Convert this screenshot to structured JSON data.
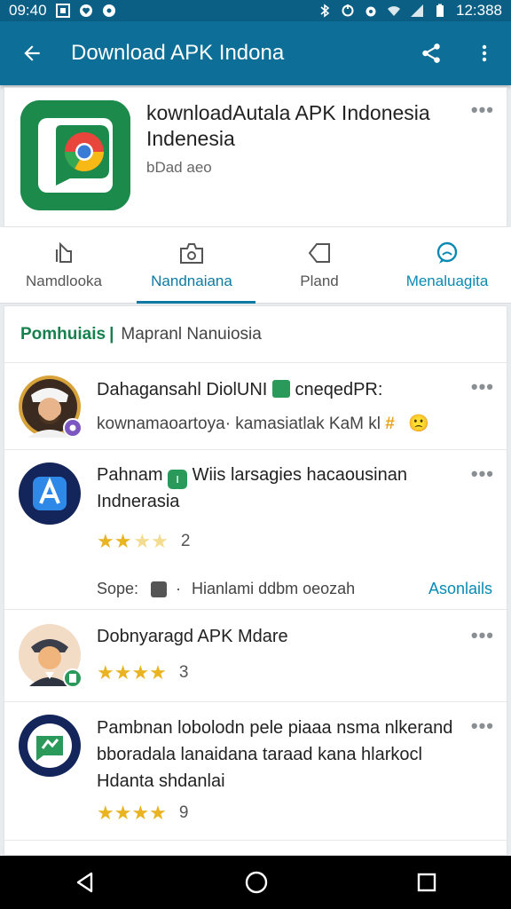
{
  "status_bar": {
    "time_left": "09:40",
    "time_right": "12:388",
    "icons": [
      "image-icon",
      "heart-icon",
      "chat-icon",
      "bluetooth-icon",
      "sync-icon",
      "alarm-icon",
      "wifi-icon",
      "signal-icon",
      "battery-icon"
    ]
  },
  "app_bar": {
    "title": "Download APK Indona",
    "back_icon": "arrow-back-icon",
    "share_icon": "share-icon",
    "menu_icon": "more-vert-icon"
  },
  "app_card": {
    "name": "kownloadAutala APK  Indonesia Indenesia",
    "subtitle": "bDad aeo",
    "more": "•••"
  },
  "tabs": [
    {
      "label": "Namdlooka",
      "icon": "download-icon",
      "active": false
    },
    {
      "label": "Nandnaiana",
      "icon": "camera-icon",
      "active": true
    },
    {
      "label": "Pland",
      "icon": "tag-icon",
      "active": false
    },
    {
      "label": "Menaluagita",
      "icon": "chat-bubble-icon",
      "active": false
    }
  ],
  "section": {
    "bold_label": "Pomhuiais",
    "separator": "|",
    "rest_label": "Mapranl Nanuiosia"
  },
  "rows": [
    {
      "title_a": "Dahagansahl DiolUNI",
      "title_b": "cneqedPR:",
      "subtitle": "kownamaoartoya· kamasiatlak KaM kl",
      "emoji": "🙁",
      "more": "•••"
    },
    {
      "title_a": "Pahnam",
      "title_b": "Wiis larsagies hacaousinan Indnerasia",
      "stars": "★★",
      "stars_off": "★★",
      "count": "2",
      "sub_label": "Sope:",
      "sub_text": "Hianlami ddbm oeozah",
      "link": "Asonlails",
      "more": "•••"
    },
    {
      "title": "Dobnyaragd APK Mdare",
      "stars": "★★★★",
      "count": "3",
      "more": "•••"
    },
    {
      "title": "Pambnan lobolodn pele piaaa nsma nlkerand bboradala lanaidana taraad kana hlarkocl Hdanta shdanlai",
      "stars": "★★★★",
      "count": "9",
      "more": "•••"
    }
  ],
  "nav": {
    "back": "nav-back-icon",
    "home": "nav-home-icon",
    "recents": "nav-recents-icon"
  },
  "colors": {
    "app_bar": "#0d6f97",
    "status_bar": "#0b5f85",
    "accent": "#0d7aa4",
    "section_green": "#17804f",
    "star": "#e9b321"
  }
}
